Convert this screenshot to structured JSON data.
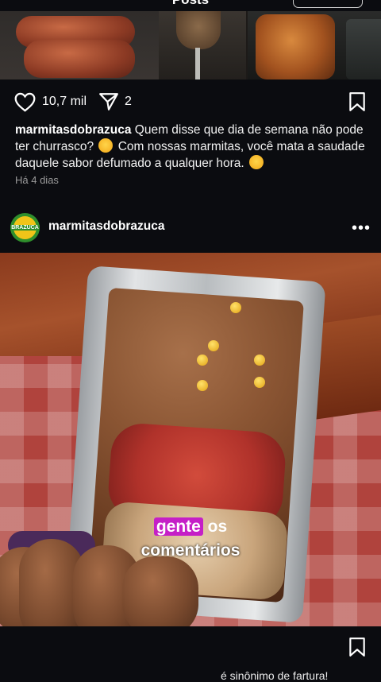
{
  "header": {
    "title": "Posts"
  },
  "prev_post": {
    "likes": "10,7 mil",
    "shares": "2",
    "caption_user": "marmitasdobrazuca",
    "caption_text_1": "Quem disse que dia de semana não pode ter churrasco?",
    "caption_text_2": "Com nossas marmitas, você mata a saudade daquele sabor defumado a qualquer hora.",
    "emoji_1": "thinking-face-emoji",
    "emoji_2": "yum-face-emoji",
    "time_ago": "Há 4 dias"
  },
  "next_post": {
    "username": "marmitasdobrazuca",
    "avatar_text": "BRAZUCA",
    "more_label": "•••",
    "overlay_highlight": "gente",
    "overlay_line1_rest": "os",
    "overlay_line2": "comentários",
    "caption_snippet": "é sinônimo de fartura!"
  },
  "colors": {
    "background": "#0b0c10",
    "highlight": "#c51fc7",
    "avatar_green": "#2f8f2c"
  }
}
